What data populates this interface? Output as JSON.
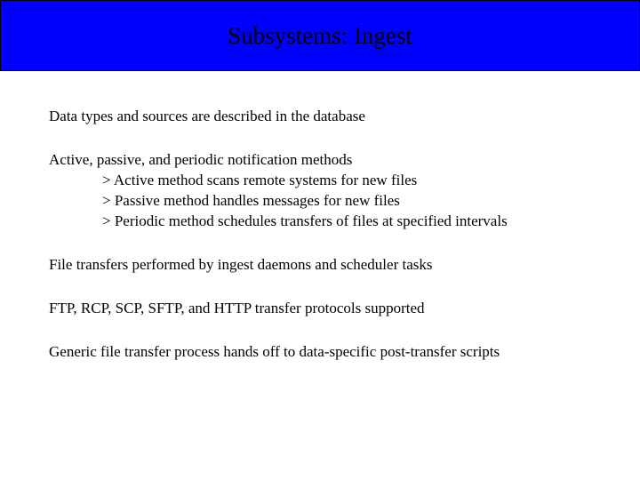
{
  "title": "Subsystems: Ingest",
  "bullets": {
    "b1": "Data types and sources are described in the database",
    "b2": {
      "main": "Active, passive, and periodic notification methods",
      "sub1": "> Active method scans remote systems for new files",
      "sub2": "> Passive method handles messages for new files",
      "sub3": "> Periodic method schedules transfers of files at specified intervals"
    },
    "b3": "File transfers performed by ingest daemons and scheduler tasks",
    "b4": "FTP, RCP, SCP, SFTP, and HTTP transfer protocols supported",
    "b5": "Generic file transfer process hands off to data-specific post-transfer scripts"
  }
}
